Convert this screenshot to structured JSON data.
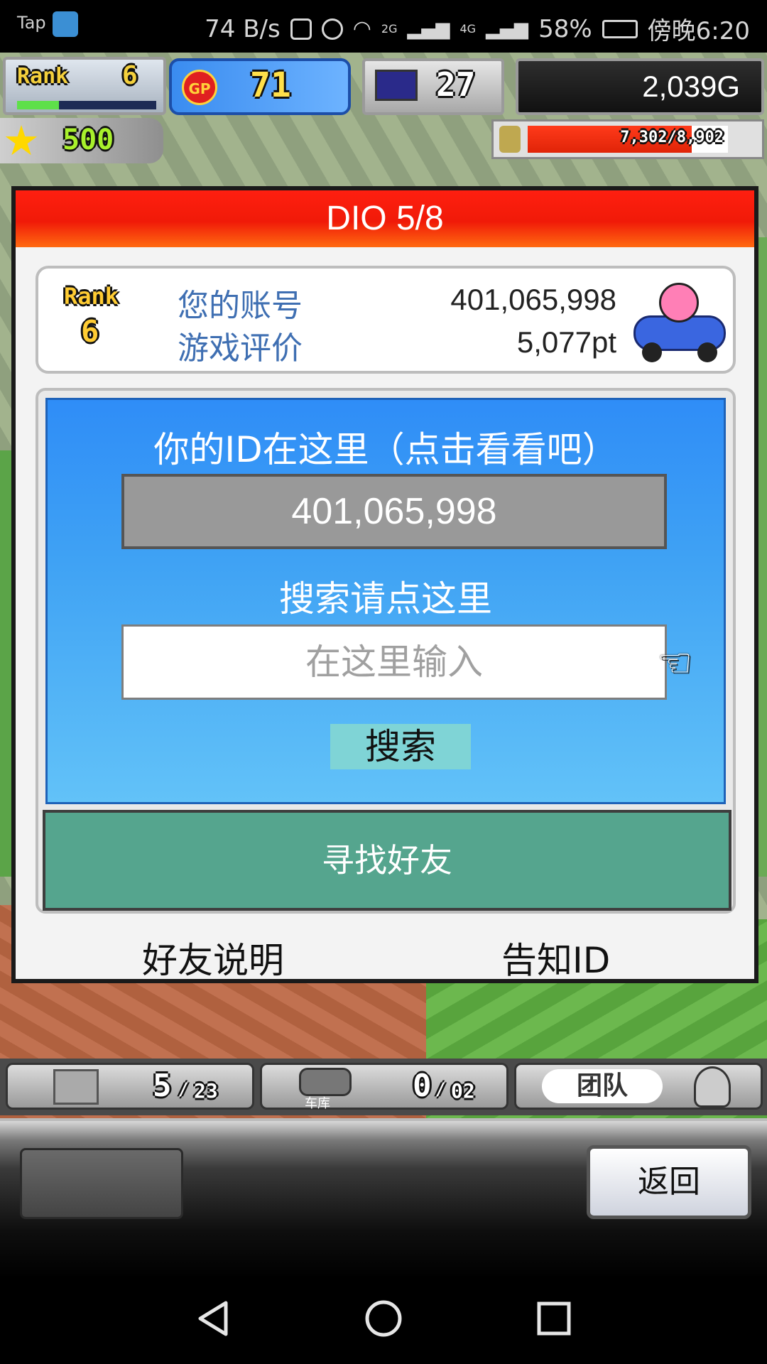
{
  "status_bar": {
    "app_label": "Tap",
    "net_speed": "74 B/s",
    "signal_2g": "2G",
    "signal_4g": "4G",
    "battery": "58%",
    "time": "傍晚6:20"
  },
  "hud": {
    "rank_label": "Rank",
    "rank_value": "6",
    "gp_label": "GP",
    "gp_value": "71",
    "computer_value": "27",
    "gold": "2,039G",
    "star_value": "500",
    "resource_bar": "7,302/8,902",
    "resource_fraction": 0.82
  },
  "dialog": {
    "title": "DIO 5/8",
    "rank_label": "Rank",
    "rank_value": "6",
    "account_label": "您的账号",
    "account_value": "401,065,998",
    "rating_label": "游戏评价",
    "rating_value": "5,077pt",
    "id_prompt": "你的ID在这里（点击看看吧）",
    "id_value": "401,065,998",
    "search_prompt": "搜索请点这里",
    "search_placeholder": "在这里输入",
    "search_button": "搜索",
    "find_friend_button": "寻找好友",
    "friend_help_link": "好友说明",
    "notify_id_link": "告知ID"
  },
  "bottom_stats": {
    "storage": "5",
    "storage_max": "23",
    "garage_label": "车库",
    "garage": "0",
    "garage_max": "02",
    "team_label": "团队"
  },
  "bottom_panel": {
    "back_button": "返回"
  },
  "colors": {
    "header_red": "#f01a08",
    "panel_blue": "#2f8df7",
    "find_friend_green": "#55a58e",
    "label_blue": "#3f6fb2"
  }
}
